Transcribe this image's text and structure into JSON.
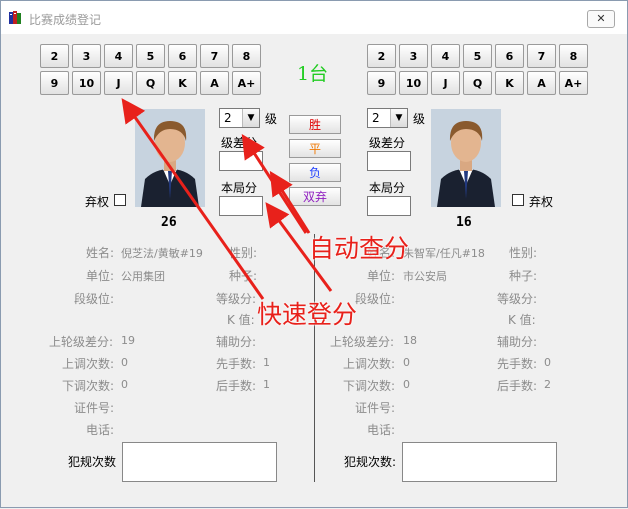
{
  "window": {
    "title": "比赛成绩登记",
    "close_label": "✕"
  },
  "cards_row1": [
    "2",
    "3",
    "4",
    "5",
    "6",
    "7",
    "8"
  ],
  "cards_row2": [
    "9",
    "10",
    "J",
    "Q",
    "K",
    "A",
    "A+"
  ],
  "table_label": "1台",
  "result_buttons": {
    "win": "胜",
    "draw": "平",
    "lose": "负",
    "double_forfeit": "双弃"
  },
  "result_colors": {
    "win": "#e00000",
    "draw": "#f07800",
    "lose": "#2040ff",
    "double_forfeit": "#9020c0"
  },
  "left": {
    "grade_value": "2",
    "grade_label": "级",
    "level_diff_label": "级差分",
    "game_score_label": "本局分",
    "forfeit_label": "弃权",
    "number": "26",
    "name_label": "姓名:",
    "name_value": "倪芝法/黄敏#19",
    "gender_label": "性别:",
    "unit_label": "单位:",
    "unit_value": "公用集团",
    "seed_label": "种子:",
    "dan_label": "段级位:",
    "grade_score_label": "等级分:",
    "k_label": "K 值:",
    "last_diff_label": "上轮级差分:",
    "last_diff_value": "19",
    "aux_label": "辅助分:",
    "up_label": "上调次数:",
    "up_value": "0",
    "first_label": "先手数:",
    "first_value": "1",
    "down_label": "下调次数:",
    "down_value": "0",
    "second_label": "后手数:",
    "second_value": "1",
    "cert_label": "证件号:",
    "phone_label": "电话:",
    "foul_label": "犯规次数"
  },
  "right": {
    "grade_value": "2",
    "grade_label": "级",
    "level_diff_label": "级差分",
    "game_score_label": "本局分",
    "forfeit_label": "弃权",
    "number": "16",
    "name_label": "姓名:",
    "name_value": "朱智军/任凡#18",
    "gender_label": "性别:",
    "unit_label": "单位:",
    "unit_value": "市公安局",
    "seed_label": "种子:",
    "dan_label": "段级位:",
    "grade_score_label": "等级分:",
    "k_label": "K 值:",
    "last_diff_label": "上轮级差分:",
    "last_diff_value": "18",
    "aux_label": "辅助分:",
    "up_label": "上调次数:",
    "up_value": "0",
    "first_label": "先手数:",
    "first_value": "0",
    "down_label": "下调次数:",
    "down_value": "0",
    "second_label": "后手数:",
    "second_value": "2",
    "cert_label": "证件号:",
    "phone_label": "电话:",
    "foul_label": "犯规次数:"
  },
  "annotations": {
    "auto_check": "自动查分",
    "quick_score": "快速登分"
  },
  "colors": {
    "annotation": "#e8211b",
    "table_label": "#22cc22"
  }
}
